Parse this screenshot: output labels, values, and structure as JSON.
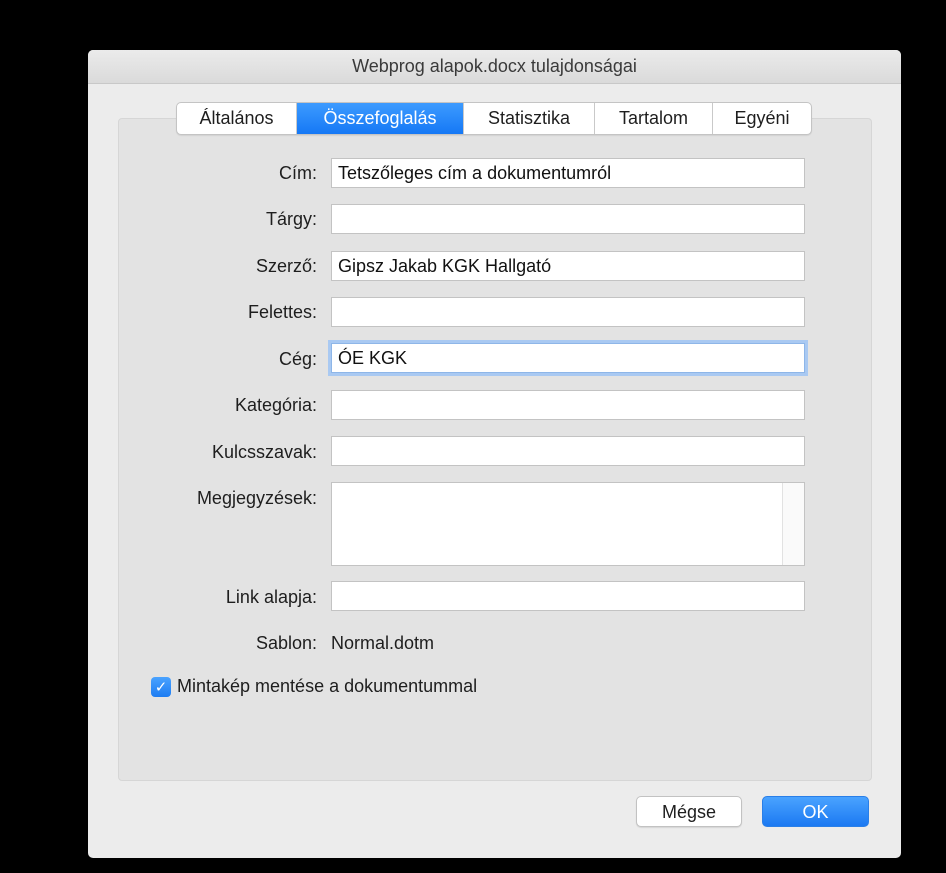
{
  "window": {
    "title": "Webprog alapok.docx tulajdonságai"
  },
  "tabs": [
    {
      "label": "Általános",
      "active": false
    },
    {
      "label": "Összefoglalás",
      "active": true
    },
    {
      "label": "Statisztika",
      "active": false
    },
    {
      "label": "Tartalom",
      "active": false
    },
    {
      "label": "Egyéni",
      "active": false
    }
  ],
  "form": {
    "title": {
      "label": "Cím:",
      "value": "Tetszőleges cím a dokumentumról"
    },
    "subject": {
      "label": "Tárgy:",
      "value": ""
    },
    "author": {
      "label": "Szerző:",
      "value": "Gipsz Jakab KGK Hallgató"
    },
    "manager": {
      "label": "Felettes:",
      "value": ""
    },
    "company": {
      "label": "Cég:",
      "value": "ÓE KGK"
    },
    "category": {
      "label": "Kategória:",
      "value": ""
    },
    "keywords": {
      "label": "Kulcsszavak:",
      "value": ""
    },
    "comments": {
      "label": "Megjegyzések:",
      "value": ""
    },
    "hyperlink_base": {
      "label": "Link alapja:",
      "value": ""
    },
    "template": {
      "label": "Sablon:",
      "value": "Normal.dotm"
    }
  },
  "save_thumbnail": {
    "label": "Mintakép mentése a dokumentummal",
    "checked": true,
    "check_glyph": "✓"
  },
  "buttons": {
    "cancel": "Mégse",
    "ok": "OK"
  },
  "colors": {
    "accent": "#1d7cf2",
    "focus_ring": "#a9c9f2"
  }
}
